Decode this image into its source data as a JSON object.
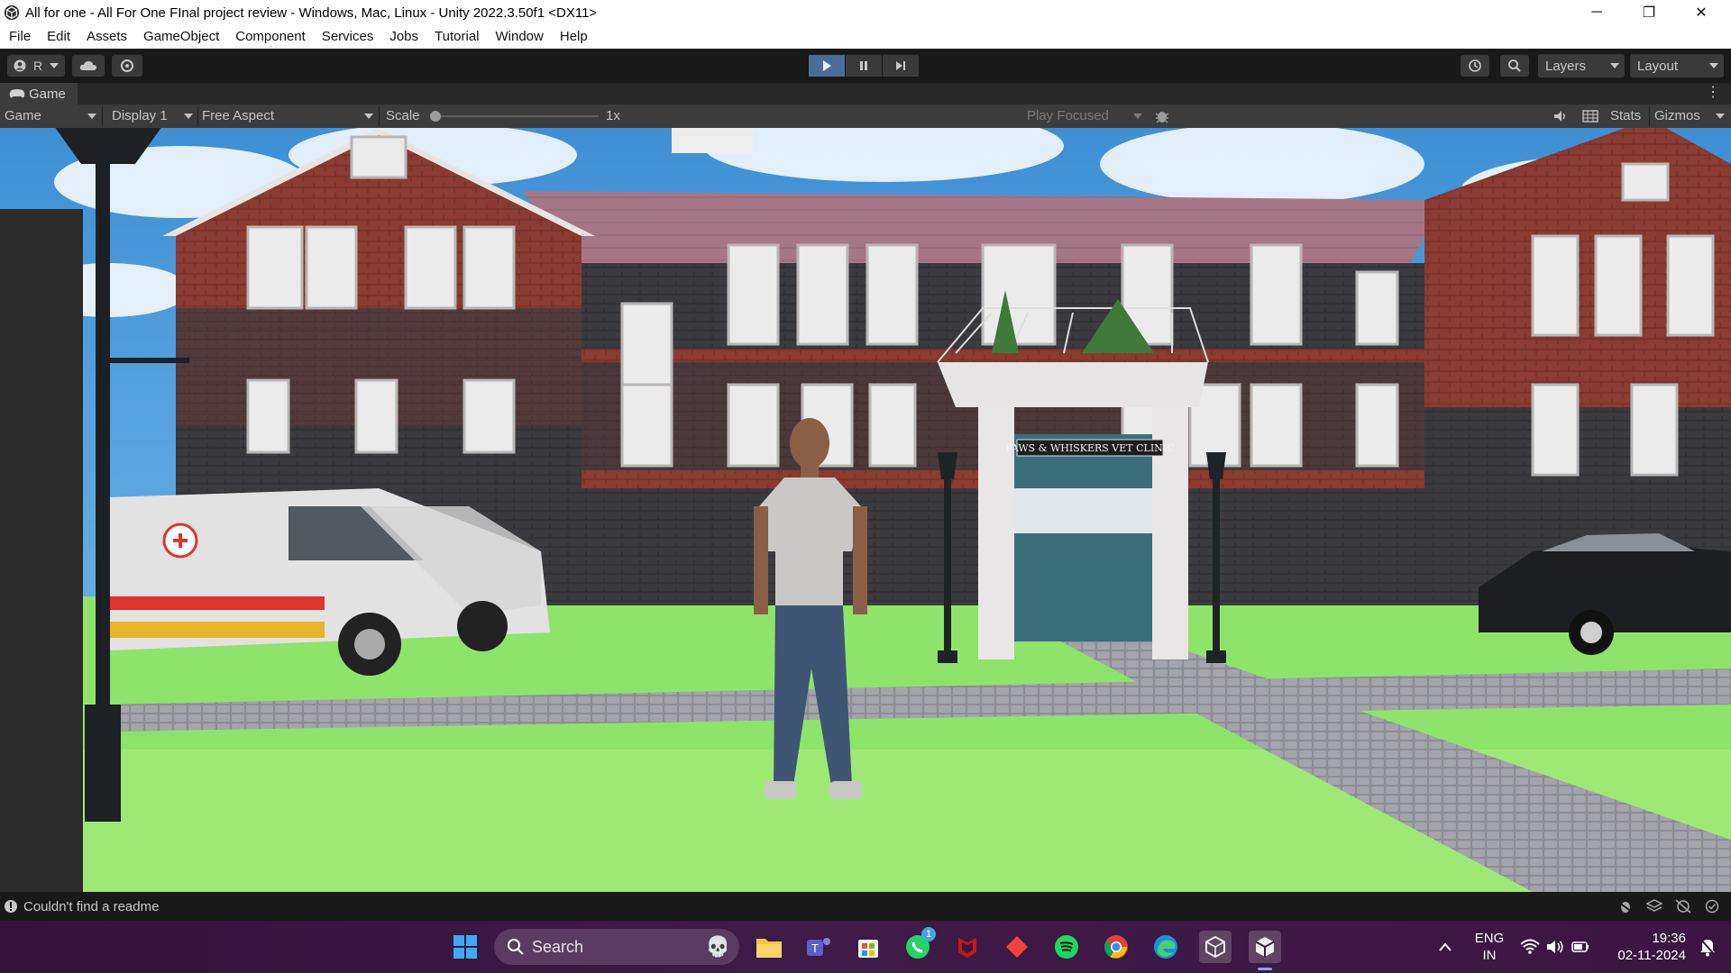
{
  "window": {
    "title": "All for one - All For One FInal project review - Windows, Mac, Linux - Unity 2022.3.50f1 <DX11>",
    "minimize": "─",
    "restore": "❐",
    "close": "✕"
  },
  "menu": [
    "File",
    "Edit",
    "Assets",
    "GameObject",
    "Component",
    "Services",
    "Jobs",
    "Tutorial",
    "Window",
    "Help"
  ],
  "toolbar": {
    "account_initial": "R",
    "layers_label": "Layers",
    "layout_label": "Layout"
  },
  "game_tab": {
    "label": "Game"
  },
  "game_bar": {
    "view_mode": "Game",
    "display": "Display 1",
    "aspect": "Free Aspect",
    "scale_label": "Scale",
    "scale_value": "1x",
    "scale_level": 0,
    "play_mode": "Play Focused",
    "stats": "Stats",
    "gizmos": "Gizmos"
  },
  "scene": {
    "clinic_sign": "PAWS & WHISKERS VET CLINIC"
  },
  "status": {
    "message": "Couldn't find a readme"
  },
  "taskbar": {
    "search_placeholder": "Search",
    "whatsapp_badge": "1",
    "language_line1": "ENG",
    "language_line2": "IN",
    "time": "19:36",
    "date": "02-11-2024"
  },
  "colors": {
    "unity_dark": "#191919",
    "unity_panel": "#3c3c3c",
    "taskbar": "#3a1640",
    "sky": "#4f9fdf",
    "grass": "#8ee46a",
    "brick": "#8a3b32"
  }
}
